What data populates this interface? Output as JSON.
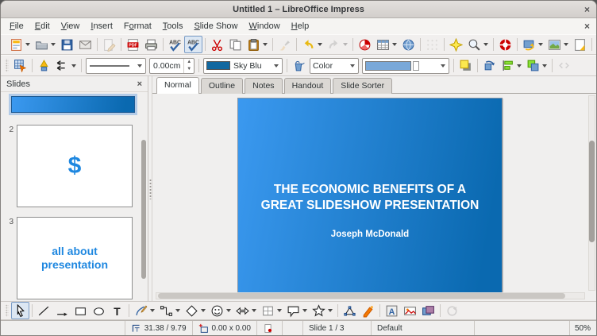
{
  "window": {
    "title": "Untitled 1 – LibreOffice Impress",
    "close_glyph": "×"
  },
  "menubar": {
    "close_glyph": "×",
    "items": [
      {
        "label": "File",
        "u": 0
      },
      {
        "label": "Edit",
        "u": 0
      },
      {
        "label": "View",
        "u": 0
      },
      {
        "label": "Insert",
        "u": 0
      },
      {
        "label": "Format",
        "u": 1
      },
      {
        "label": "Tools",
        "u": 0
      },
      {
        "label": "Slide Show",
        "u": 0
      },
      {
        "label": "Window",
        "u": 0
      },
      {
        "label": "Help",
        "u": 0
      }
    ]
  },
  "toolbar_standard": [
    {
      "handle": true
    },
    {
      "icon": "new-presentation",
      "dropdown": true
    },
    {
      "icon": "open-folder",
      "dropdown": true
    },
    {
      "icon": "save-floppy"
    },
    {
      "icon": "email-envelope"
    },
    {
      "sep": true
    },
    {
      "icon": "edit-file-pencil",
      "disabled": true
    },
    {
      "sep": true
    },
    {
      "icon": "export-pdf"
    },
    {
      "icon": "print"
    },
    {
      "sep": true
    },
    {
      "icon": "spelling-check"
    },
    {
      "icon": "auto-spellcheck",
      "pressed": true
    },
    {
      "sep": true
    },
    {
      "icon": "cut-scissors"
    },
    {
      "icon": "copy"
    },
    {
      "icon": "paste-clipboard",
      "dropdown": true
    },
    {
      "sep": true
    },
    {
      "icon": "clone-formatting",
      "disabled": true
    },
    {
      "sep": true
    },
    {
      "icon": "undo-arrow",
      "dropdown": true
    },
    {
      "icon": "redo-arrow",
      "dropdown": true,
      "disabled": true
    },
    {
      "sep": true
    },
    {
      "icon": "chart-pie"
    },
    {
      "icon": "table-grid",
      "dropdown": true
    },
    {
      "icon": "hyperlink-globe"
    },
    {
      "sep": true
    },
    {
      "icon": "display-grid",
      "disabled": true
    },
    {
      "sep": true
    },
    {
      "icon": "navigator-star"
    },
    {
      "icon": "zoom-magnifier",
      "dropdown": true
    },
    {
      "sep": true
    },
    {
      "icon": "help-lifebuoy"
    },
    {
      "sep": true
    },
    {
      "icon": "new-slide",
      "dropdown": true
    },
    {
      "icon": "slide-layout",
      "dropdown": true
    },
    {
      "icon": "slide-design"
    },
    {
      "sep": true
    },
    {
      "icon": "start-slideshow"
    }
  ],
  "toolbar_line_filling": {
    "left_icons": [
      {
        "handle": true
      },
      {
        "icon": "edit-points"
      },
      {
        "sep": true
      },
      {
        "icon": "arrowheads"
      },
      {
        "icon": "arrow-style",
        "dropdown": true
      },
      {
        "sep": true
      }
    ],
    "line_width_value": "0.00cm",
    "line_color_value": "Sky Blu",
    "fill_type_value": "Color",
    "mid_icons": [
      {
        "sep": true
      },
      {
        "icon": "area-fill"
      }
    ],
    "right_icons": [
      {
        "sep": true
      },
      {
        "icon": "shadow"
      },
      {
        "sep": true
      },
      {
        "icon": "rotate-shape"
      },
      {
        "icon": "align-objects",
        "dropdown": true
      },
      {
        "icon": "arrange-objects",
        "dropdown": true
      },
      {
        "sep": true
      },
      {
        "icon": "double-chevron",
        "disabled": true
      }
    ]
  },
  "view_tabs": {
    "items": [
      "Normal",
      "Outline",
      "Notes",
      "Handout",
      "Slide Sorter"
    ],
    "active": "Normal"
  },
  "slides_panel": {
    "title": "Slides",
    "close_glyph": "×",
    "slide2_number": "2",
    "slide2_text": "$",
    "slide3_number": "3",
    "slide3_text": "all about presentation"
  },
  "canvas": {
    "title_line1": "THE ECONOMIC BENEFITS OF A",
    "title_line2": "GREAT SLIDESHOW PRESENTATION",
    "subtitle": "Joseph McDonald"
  },
  "toolbar_drawing": [
    {
      "handle": true
    },
    {
      "icon": "select-arrow",
      "pressed": true
    },
    {
      "sep": true
    },
    {
      "icon": "line"
    },
    {
      "icon": "line-ends-arrow"
    },
    {
      "icon": "rectangle"
    },
    {
      "icon": "ellipse"
    },
    {
      "icon": "text-box"
    },
    {
      "sep": true
    },
    {
      "icon": "curve",
      "dropdown": true
    },
    {
      "icon": "connector",
      "dropdown": true
    },
    {
      "icon": "basic-shapes",
      "dropdown": true
    },
    {
      "icon": "symbol-shapes",
      "dropdown": true
    },
    {
      "icon": "block-arrows",
      "dropdown": true
    },
    {
      "icon": "flowchart",
      "dropdown": true
    },
    {
      "icon": "callouts",
      "dropdown": true
    },
    {
      "icon": "stars",
      "dropdown": true
    },
    {
      "sep": true
    },
    {
      "icon": "points"
    },
    {
      "icon": "glue-points"
    },
    {
      "sep": true
    },
    {
      "icon": "fontwork"
    },
    {
      "icon": "insert-image"
    },
    {
      "icon": "gallery"
    },
    {
      "sep": true
    },
    {
      "icon": "rotate",
      "disabled": true
    }
  ],
  "statusbar": {
    "position": "31.38 / 9.79",
    "size": "0.00 x 0.00",
    "slide": "Slide 1 / 3",
    "style": "Default",
    "zoom": "50%"
  },
  "colors": {
    "slide_gradient_start": "#3b99f0",
    "slide_gradient_end": "#0a69b0",
    "accent_blue": "#1e87e0",
    "line_color_swatch": "#1268a0",
    "fill_color_swatch": "#79a8d9"
  }
}
